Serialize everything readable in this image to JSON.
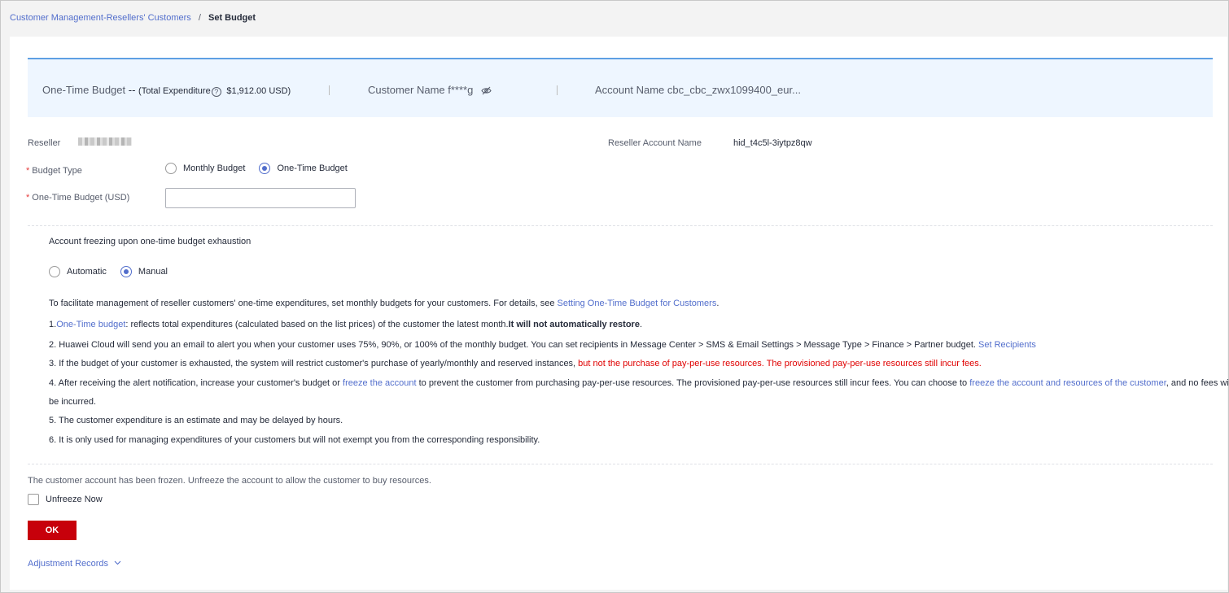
{
  "breadcrumb": {
    "parent": "Customer Management-Resellers' Customers",
    "separator": "/",
    "current": "Set Budget"
  },
  "summary": {
    "budget_label": "One-Time Budget",
    "budget_value": "--",
    "total_expenditure_prefix": "(Total Expenditure",
    "total_expenditure_value": "$1,912.00 USD)",
    "customer_name_label": "Customer Name",
    "customer_name_value": "f****g",
    "account_name_label": "Account Name",
    "account_name_value": "cbc_cbc_zwx1099400_eur..."
  },
  "form": {
    "reseller_label": "Reseller",
    "reseller_account_label": "Reseller Account Name",
    "reseller_account_value": "hid_t4c5l-3iytpz8qw",
    "budget_type_label": "Budget Type",
    "budget_type_options": [
      "Monthly Budget",
      "One-Time Budget"
    ],
    "budget_type_selected": "One-Time Budget",
    "one_time_budget_label": "One-Time Budget (USD)",
    "one_time_budget_value": "",
    "required_mark": "*"
  },
  "freeze": {
    "title": "Account freezing upon one-time budget exhaustion",
    "options": [
      "Automatic",
      "Manual"
    ],
    "selected": "Manual"
  },
  "notes": {
    "intro_text": "To facilitate management of reseller customers' one-time expenditures, set monthly budgets for your customers. For details, see ",
    "intro_link": "Setting One-Time Budget for Customers",
    "intro_end": ".",
    "n1_prefix": "1.",
    "n1_link": "One-Time budget",
    "n1_text": ": reflects total expenditures (calculated based on the list prices) of the customer the latest month.",
    "n1_bold": "It will not automatically restore",
    "n1_end": ".",
    "n2_text": "2. Huawei Cloud will send you an email to alert you when your customer uses 75%, 90%, or 100% of the monthly budget. You can set recipients in Message Center > SMS & Email Settings > Message Type > Finance > Partner budget. ",
    "n2_link": "Set Recipients",
    "n3_text": "3. If the budget of your customer is exhausted, the system will restrict customer's purchase of yearly/monthly and reserved instances, ",
    "n3_red": "but not the purchase of pay-per-use resources. The provisioned pay-per-use resources still incur fees.",
    "n4_text1": "4. After receiving the alert notification, increase your customer's budget or ",
    "n4_link1": "freeze the account",
    "n4_text2": " to prevent the customer from purchasing pay-per-use resources. The provisioned pay-per-use resources still incur fees. You can choose to ",
    "n4_link2": "freeze the account and resources of the customer",
    "n4_text3": ", and no fees will",
    "n4_cont": "be incurred.",
    "n5": "5. The customer expenditure is an estimate and may be delayed by hours.",
    "n6": "6. It is only used for managing expenditures of your customers but will not exempt you from the corresponding responsibility."
  },
  "frozen": {
    "message": "The customer account has been frozen. Unfreeze the account to allow the customer to buy resources.",
    "unfreeze_label": "Unfreeze Now",
    "unfreeze_checked": false
  },
  "actions": {
    "ok_label": "OK",
    "adjustment_records_label": "Adjustment Records"
  },
  "colors": {
    "accent": "#526ecc",
    "primary_button": "#c7000b",
    "summary_bg": "#eef6ff",
    "summary_border": "#5e9fe3",
    "warning_text": "#e00000"
  },
  "icons": [
    "help-icon",
    "eye-off-icon",
    "chevron-down-icon"
  ]
}
